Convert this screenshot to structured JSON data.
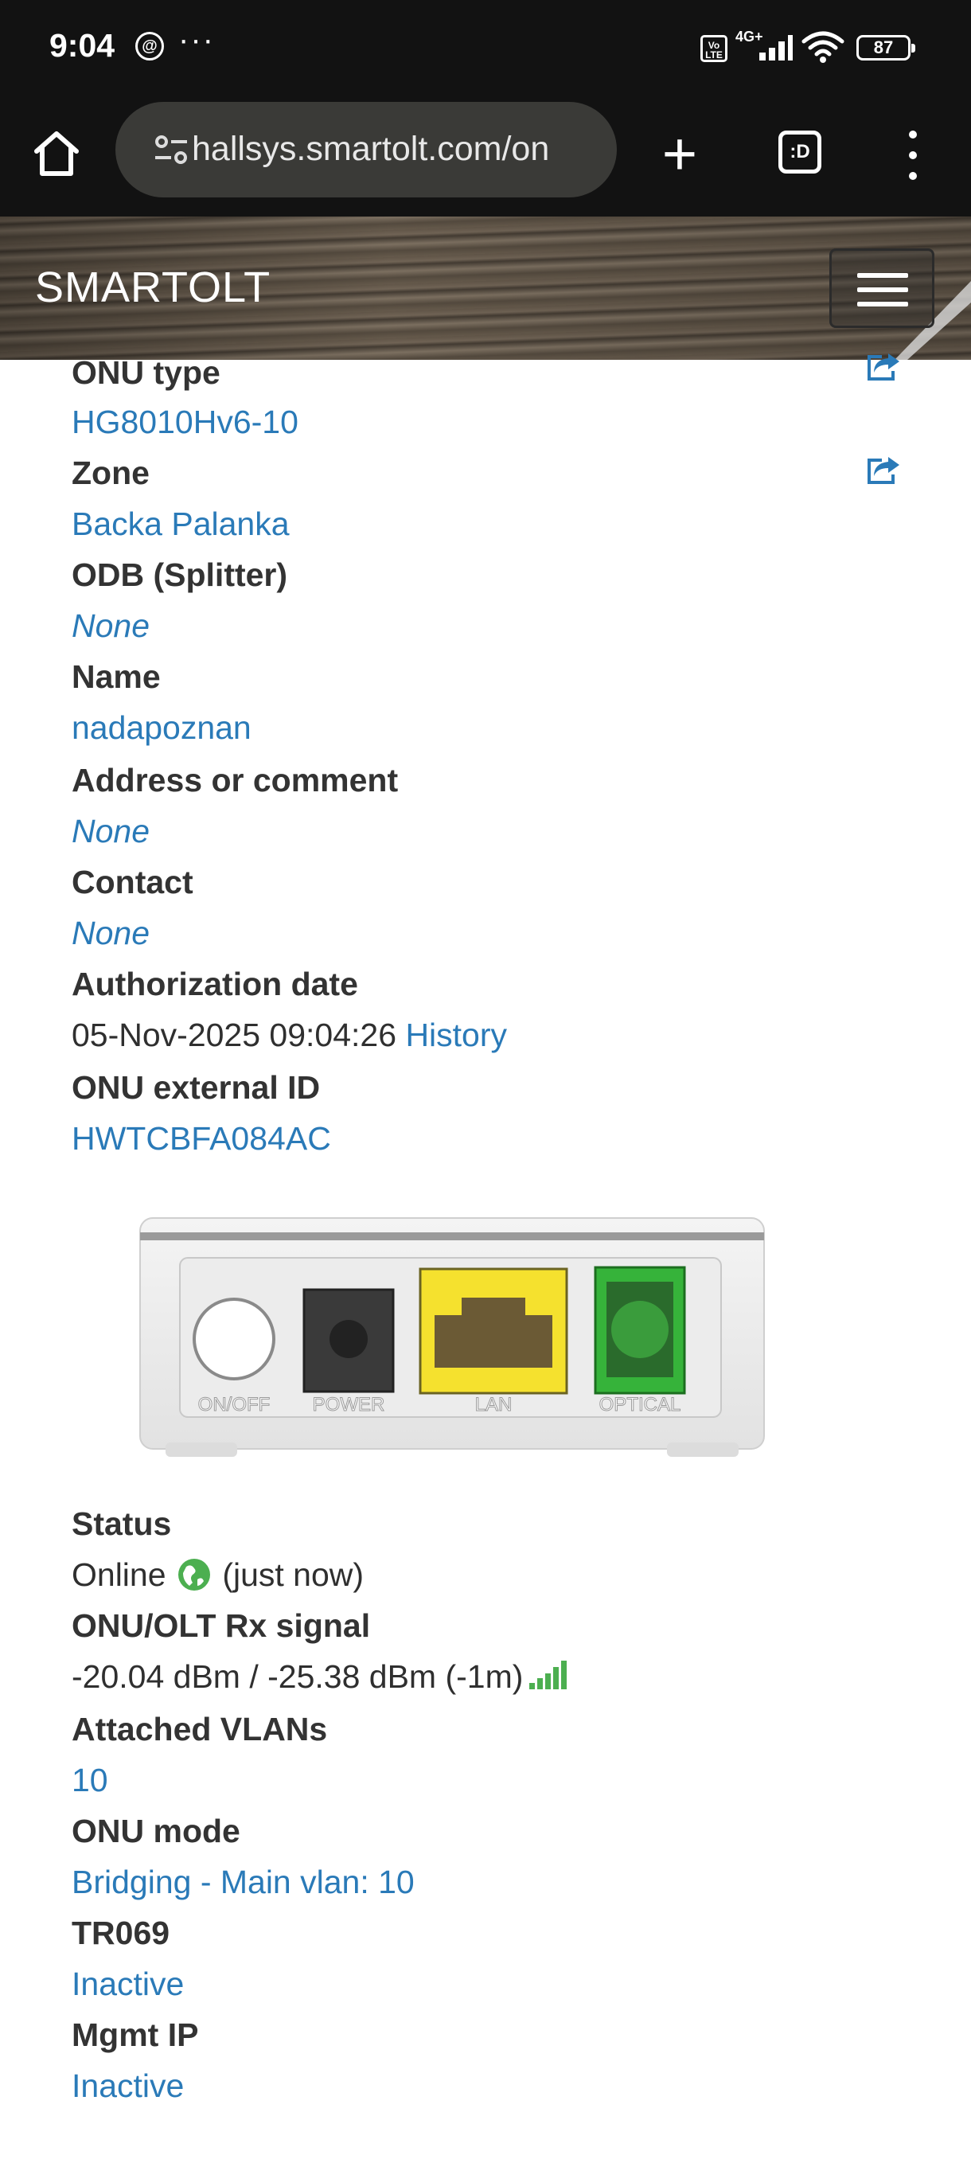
{
  "status_bar": {
    "time": "9:04",
    "dots": "···",
    "volte": "Vo LTE",
    "network": "4G+",
    "battery": "87"
  },
  "browser": {
    "url": "hallsys.smartolt.com/on",
    "tab_count": ":D"
  },
  "site": {
    "brand": "SMARTOLT"
  },
  "details": {
    "onu_type_label": "ONU type",
    "onu_type_value": "HG8010Hv6-10",
    "zone_label": "Zone",
    "zone_value": "Backa Palanka",
    "odb_label": "ODB (Splitter)",
    "odb_value": "None",
    "name_label": "Name",
    "name_value": "nadapoznan",
    "address_label": "Address or comment",
    "address_value": "None",
    "contact_label": "Contact",
    "contact_value": "None",
    "auth_date_label": "Authorization date",
    "auth_date_value": "05-Nov-2025 09:04:26",
    "history_link": "History",
    "external_id_label": "ONU external ID",
    "external_id_value": "HWTCBFA084AC"
  },
  "device_ports": [
    "ON/OFF",
    "POWER",
    "LAN",
    "OPTICAL"
  ],
  "status_info": {
    "status_label": "Status",
    "status_value": "Online",
    "status_time": "(just now)",
    "signal_label": "ONU/OLT Rx signal",
    "signal_value": "-20.04 dBm / -25.38 dBm (-1m)",
    "vlans_label": "Attached VLANs",
    "vlans_value": "10",
    "mode_label": "ONU mode",
    "mode_value": "Bridging - Main vlan: 10",
    "tr069_label": "TR069",
    "tr069_value": "Inactive",
    "mgmt_label": "Mgmt IP",
    "mgmt_value": "Inactive"
  }
}
